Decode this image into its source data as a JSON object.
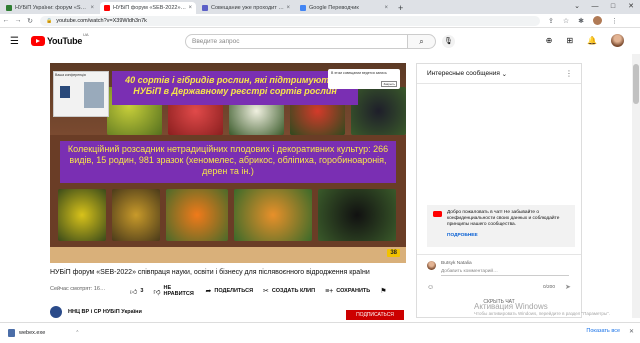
{
  "browser": {
    "tabs": [
      {
        "label": "НУБіП України: форум «SEB-202…",
        "active": false,
        "color": "#2e7d32"
      },
      {
        "label": "НУБіП форум «SEB-2022» …",
        "active": true,
        "color": "#ff0000"
      },
      {
        "label": "Совещание уже проходит в …",
        "active": false,
        "color": "#5b5fc7"
      },
      {
        "label": "Google Переводчик",
        "active": false,
        "color": "#4285f4"
      }
    ],
    "url": "youtube.com/watch?v=X39Wldh3n7k"
  },
  "youtube": {
    "region": "UA",
    "logo_word": "YouTube",
    "search_placeholder": "Введите запрос"
  },
  "video": {
    "slide_heading": "40 сортів і гібридів рослин, які підтримуються НУБіП в Державному реєстрі сортів рослин",
    "slide_text": "Колекційний розсадник нетрадиційних плодових і декоративних культур: 266 видів, 15 родин, 981 зразок (хеномелес, абрикос, обліпиха, горобиноаронія, дерен та ін.)",
    "call_title": "Ваша конференція",
    "notif_text": "В этом совещании ведется запись",
    "notif_button": "Закрыть",
    "slide_number": "38"
  },
  "title": "НУБіП форум «SEB-2022» співпраця науки, освіти і бізнесу для післявоєнного відродження країни",
  "views": "Сейчас смотрят: 16…",
  "actions": {
    "likes": "3",
    "dislike": "НЕ НРАВИТСЯ",
    "share": "ПОДЕЛИТЬСЯ",
    "clip": "СОЗДАТЬ КЛИП",
    "save": "СОХРАНИТЬ"
  },
  "channel": {
    "name": "ННЦ ВР і СР НУБіП України",
    "subscribe": "ПОДПИСАТЬСЯ"
  },
  "chat": {
    "header": "Интересные сообщения",
    "welcome": "Добро пожаловать в чат! Не забывайте о конфиденциальности своих данных и соблюдайте принципы нашего сообщества.",
    "welcome_link": "ПОДРОБНЕЕ",
    "username": "Butsyk Natalia",
    "input_placeholder": "Добавить комментарий…",
    "counter": "0/200",
    "hide": "СКРЫТЬ ЧАТ"
  },
  "watermark": {
    "title": "Активация Windows",
    "text": "Чтобы активировать Windows, перейдите в раздел \"Параметры\"."
  },
  "download": {
    "file": "webex.exe",
    "show_all": "Показать все"
  }
}
